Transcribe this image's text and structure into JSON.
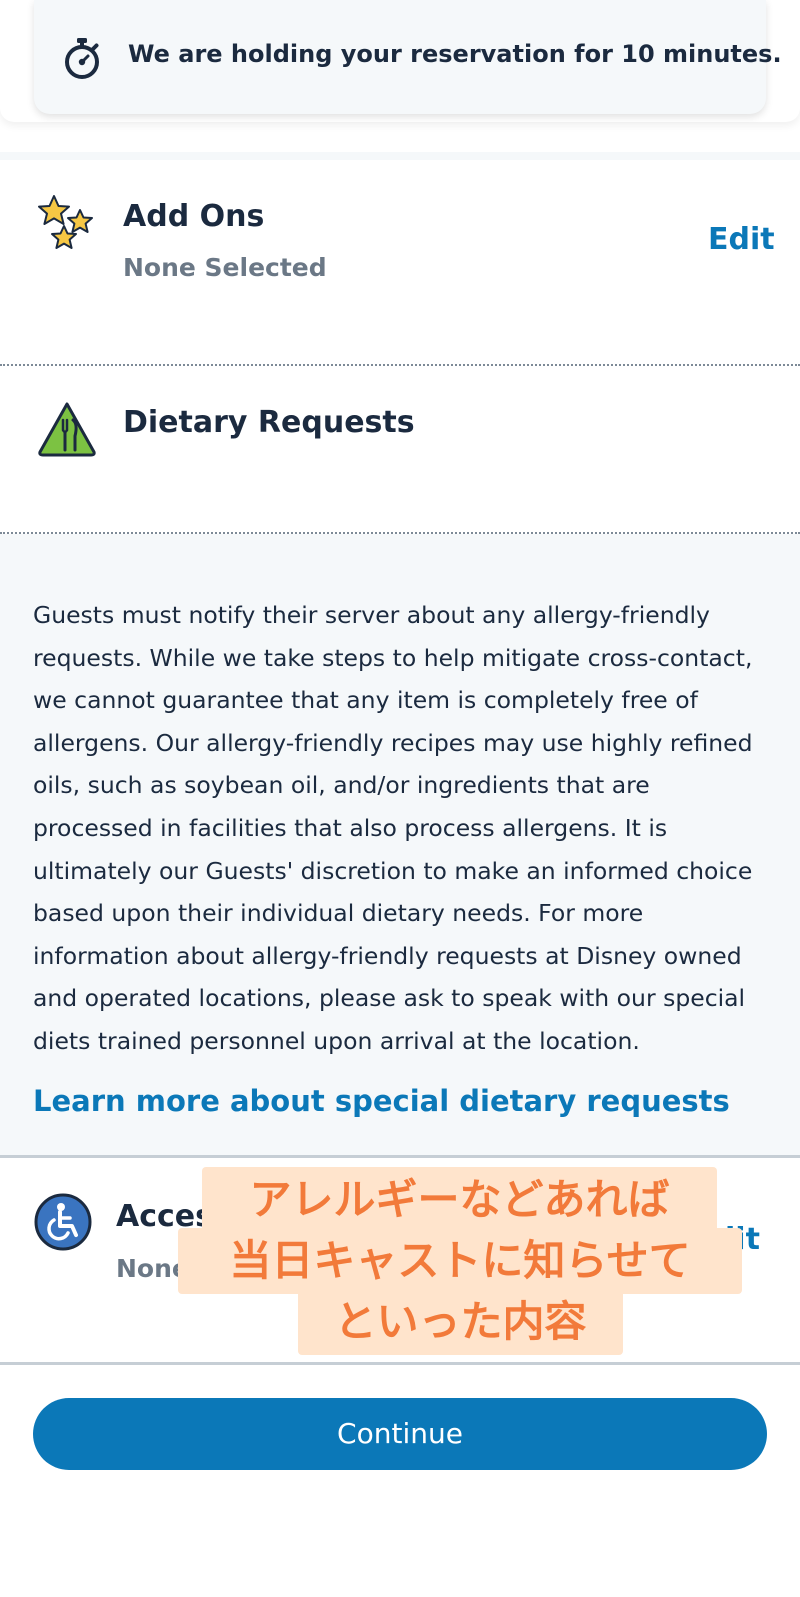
{
  "timer": {
    "message": "We are holding your reservation for 10 minutes."
  },
  "add_ons": {
    "title": "Add Ons",
    "status": "None Selected",
    "edit_label": "Edit"
  },
  "dietary": {
    "title": "Dietary Requests",
    "notice": "Guests must notify their server about any allergy-friendly requests. While we take steps to help mitigate cross-contact, we cannot guarantee that any item is completely free of allergens. Our allergy-friendly recipes may use highly refined oils, such as soybean oil, and/or ingredients that are processed in facilities that also process allergens. It is ultimately our Guests' discretion to make an informed choice based upon their individual dietary needs. For more information about allergy-friendly requests at Disney owned and operated locations, please ask to speak with our special diets trained personnel upon arrival at the location.",
    "link_label": "Learn more about special dietary requests"
  },
  "accessibility": {
    "title_visible": "Acces",
    "status_visible": "None",
    "edit_visible": "lit"
  },
  "overlay": {
    "line1": "アレルギーなどあれば",
    "line2": "当日キャストに知らせて",
    "line3": "といった内容"
  },
  "continue_label": "Continue",
  "colors": {
    "accent": "#0b78b8",
    "text": "#1b2a3f",
    "muted": "#6b7886",
    "overlay_text": "#f27a3a",
    "overlay_bg": "#ffe4cc",
    "dietary_icon_green": "#7cc242",
    "star_yellow": "#f6c744",
    "accessibility_icon_blue": "#3a74c0"
  },
  "icons": [
    "stopwatch-icon",
    "stars-icon",
    "fork-knife-icon",
    "wheelchair-icon"
  ]
}
